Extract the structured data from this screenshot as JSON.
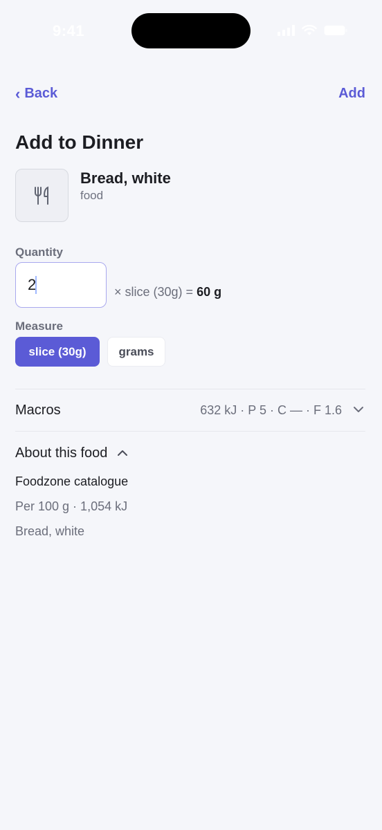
{
  "status_bar": {
    "time": "9:41",
    "icons": [
      "cellular-signal-icon",
      "wifi-icon",
      "battery-icon"
    ]
  },
  "nav": {
    "back_label": "Back",
    "back_icon": "chevron-left-icon",
    "add_label": "Add"
  },
  "page": {
    "title": "Add to Dinner"
  },
  "food": {
    "icon": "fork-knife-icon",
    "name": "Bread, white",
    "kind": "food"
  },
  "quantity": {
    "label": "Quantity",
    "value": "2",
    "multiplier_text": "× slice (30g) =",
    "total": "60 g"
  },
  "measure": {
    "label": "Measure",
    "options": [
      {
        "label": "slice (30g)",
        "selected": true
      },
      {
        "label": "grams",
        "selected": false
      }
    ]
  },
  "macros": {
    "label": "Macros",
    "summary": "632 kJ · P 5 · C — · F 1.6",
    "expanded": false,
    "icon": "chevron-down-icon"
  },
  "about": {
    "label": "About this food",
    "expanded": true,
    "icon": "chevron-up-icon",
    "source": "Foodzone catalogue",
    "per": "Per 100 g · 1,054 kJ",
    "description": "Bread, white"
  },
  "colors": {
    "accent": "#5b5bd6",
    "background": "#f5f6fa",
    "text_primary": "#1c1d22",
    "text_secondary": "#6b6e7b"
  }
}
